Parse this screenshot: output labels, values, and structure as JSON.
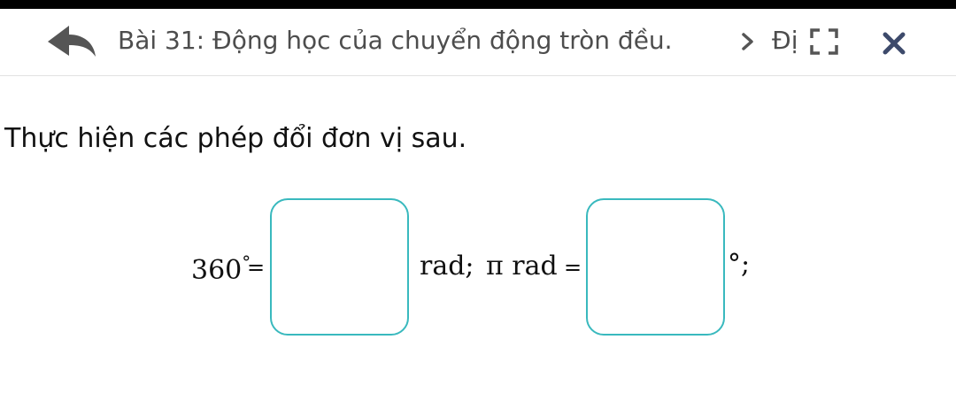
{
  "header": {
    "title": "Bài 31: Động học của chuyển động tròn đều.",
    "breadcrumb_next": "Đị"
  },
  "question": {
    "instruction": "Thực hiện các phép đổi đơn vị sau.",
    "part1": {
      "lhs": "360",
      "degree": "°",
      "equals": "=",
      "unit_after": "rad;",
      "answer_value": ""
    },
    "part2": {
      "lhs": "π rad",
      "equals": "=",
      "unit_after": "°;",
      "answer_value": ""
    }
  },
  "colors": {
    "accent": "#39b9be",
    "icon": "#555555",
    "close_icon": "#3d4a6b",
    "title_text": "#4d4d4d"
  },
  "icons": [
    "back-arrow-icon",
    "chevron-right-icon",
    "fullscreen-icon",
    "close-icon"
  ]
}
